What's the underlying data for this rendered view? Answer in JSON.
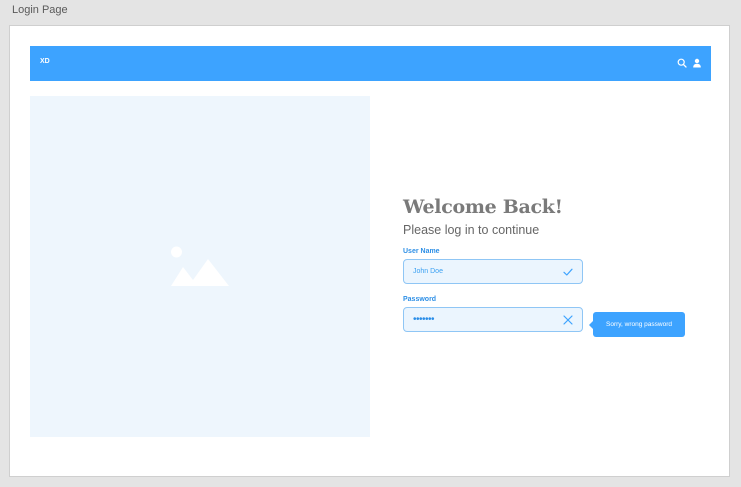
{
  "page": {
    "label": "Login Page"
  },
  "navbar": {
    "logo": "XD",
    "icons": [
      "search-icon",
      "user-icon"
    ],
    "color": "#3da3ff"
  },
  "hero": {
    "icon": "image-placeholder-icon",
    "background": "#eef6fd"
  },
  "form": {
    "title": "Welcome Back!",
    "subtitle": "Please log in to continue",
    "username": {
      "label": "User Name",
      "value": "John Doe",
      "status_icon": "check-icon"
    },
    "password": {
      "label": "Password",
      "value": "•••••••",
      "status_icon": "close-icon"
    }
  },
  "error_tooltip": {
    "text": "Sorry, wrong password"
  }
}
